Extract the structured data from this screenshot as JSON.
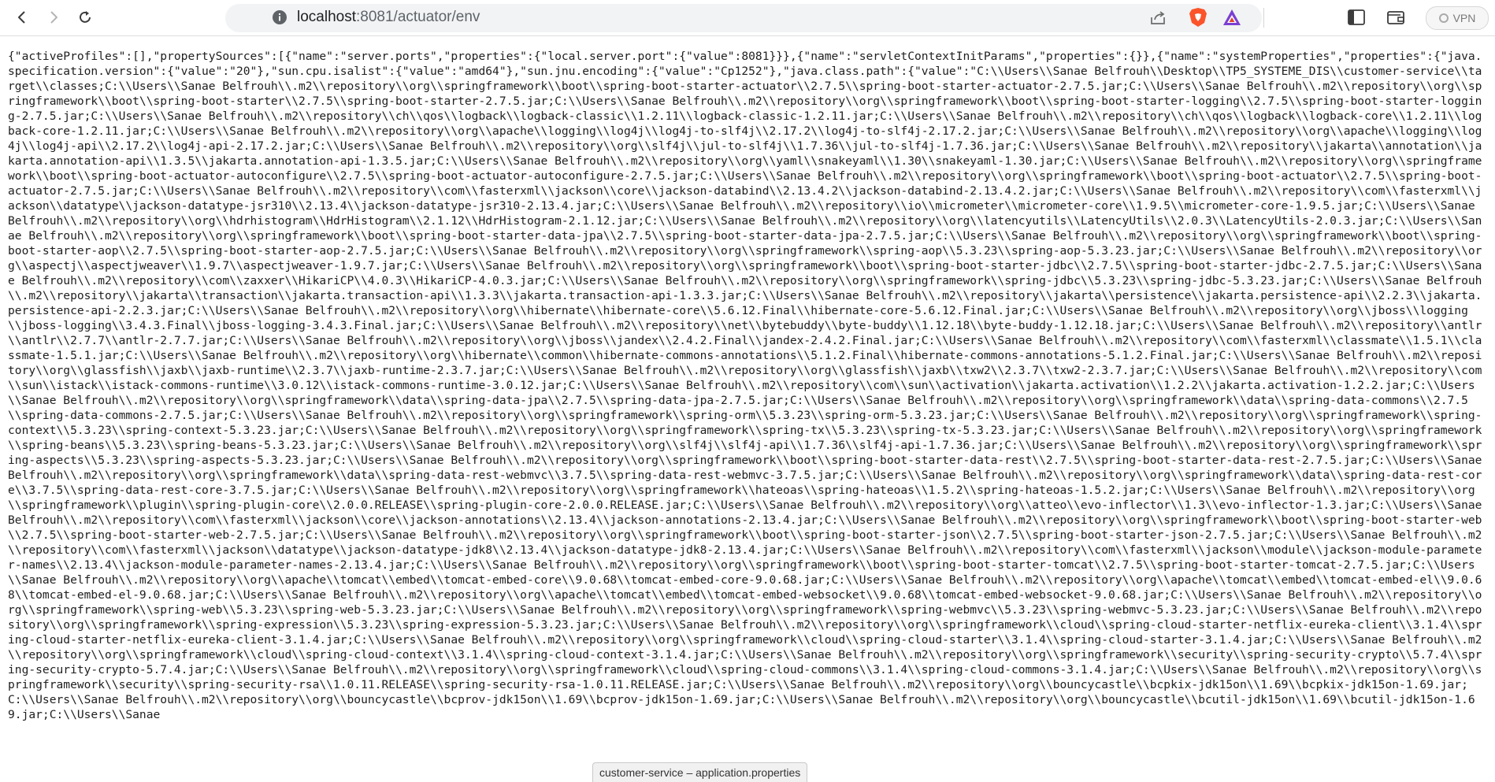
{
  "browser": {
    "url_host": "localhost",
    "url_path": ":8081/actuator/env",
    "vpn_label": "VPN",
    "colors": {
      "brave_orange": "#fb542b",
      "rewards_purple": "#7b3fd2",
      "url_bar_bg": "#f1f3f4"
    }
  },
  "page": {
    "text": "{\"activeProfiles\":[],\"propertySources\":[{\"name\":\"server.ports\",\"properties\":{\"local.server.port\":{\"value\":8081}}},{\"name\":\"servletContextInitParams\",\"properties\":{}},{\"name\":\"systemProperties\",\"properties\":{\"java.specification.version\":{\"value\":\"20\"},\"sun.cpu.isalist\":{\"value\":\"amd64\"},\"sun.jnu.encoding\":{\"value\":\"Cp1252\"},\"java.class.path\":{\"value\":\"C:\\\\Users\\\\Sanae Belfrouh\\\\Desktop\\\\TP5_SYSTEME_DIS\\\\customer-service\\\\target\\\\classes;C:\\\\Users\\\\Sanae Belfrouh\\\\.m2\\\\repository\\\\org\\\\springframework\\\\boot\\\\spring-boot-starter-actuator\\\\2.7.5\\\\spring-boot-starter-actuator-2.7.5.jar;C:\\\\Users\\\\Sanae Belfrouh\\\\.m2\\\\repository\\\\org\\\\springframework\\\\boot\\\\spring-boot-starter\\\\2.7.5\\\\spring-boot-starter-2.7.5.jar;C:\\\\Users\\\\Sanae Belfrouh\\\\.m2\\\\repository\\\\org\\\\springframework\\\\boot\\\\spring-boot-starter-logging\\\\2.7.5\\\\spring-boot-starter-logging-2.7.5.jar;C:\\\\Users\\\\Sanae Belfrouh\\\\.m2\\\\repository\\\\ch\\\\qos\\\\logback\\\\logback-classic\\\\1.2.11\\\\logback-classic-1.2.11.jar;C:\\\\Users\\\\Sanae Belfrouh\\\\.m2\\\\repository\\\\ch\\\\qos\\\\logback\\\\logback-core\\\\1.2.11\\\\logback-core-1.2.11.jar;C:\\\\Users\\\\Sanae Belfrouh\\\\.m2\\\\repository\\\\org\\\\apache\\\\logging\\\\log4j\\\\log4j-to-slf4j\\\\2.17.2\\\\log4j-to-slf4j-2.17.2.jar;C:\\\\Users\\\\Sanae Belfrouh\\\\.m2\\\\repository\\\\org\\\\apache\\\\logging\\\\log4j\\\\log4j-api\\\\2.17.2\\\\log4j-api-2.17.2.jar;C:\\\\Users\\\\Sanae Belfrouh\\\\.m2\\\\repository\\\\org\\\\slf4j\\\\jul-to-slf4j\\\\1.7.36\\\\jul-to-slf4j-1.7.36.jar;C:\\\\Users\\\\Sanae Belfrouh\\\\.m2\\\\repository\\\\jakarta\\\\annotation\\\\jakarta.annotation-api\\\\1.3.5\\\\jakarta.annotation-api-1.3.5.jar;C:\\\\Users\\\\Sanae Belfrouh\\\\.m2\\\\repository\\\\org\\\\yaml\\\\snakeyaml\\\\1.30\\\\snakeyaml-1.30.jar;C:\\\\Users\\\\Sanae Belfrouh\\\\.m2\\\\repository\\\\org\\\\springframework\\\\boot\\\\spring-boot-actuator-autoconfigure\\\\2.7.5\\\\spring-boot-actuator-autoconfigure-2.7.5.jar;C:\\\\Users\\\\Sanae Belfrouh\\\\.m2\\\\repository\\\\org\\\\springframework\\\\boot\\\\spring-boot-actuator\\\\2.7.5\\\\spring-boot-actuator-2.7.5.jar;C:\\\\Users\\\\Sanae Belfrouh\\\\.m2\\\\repository\\\\com\\\\fasterxml\\\\jackson\\\\core\\\\jackson-databind\\\\2.13.4.2\\\\jackson-databind-2.13.4.2.jar;C:\\\\Users\\\\Sanae Belfrouh\\\\.m2\\\\repository\\\\com\\\\fasterxml\\\\jackson\\\\datatype\\\\jackson-datatype-jsr310\\\\2.13.4\\\\jackson-datatype-jsr310-2.13.4.jar;C:\\\\Users\\\\Sanae Belfrouh\\\\.m2\\\\repository\\\\io\\\\micrometer\\\\micrometer-core\\\\1.9.5\\\\micrometer-core-1.9.5.jar;C:\\\\Users\\\\Sanae Belfrouh\\\\.m2\\\\repository\\\\org\\\\hdrhistogram\\\\HdrHistogram\\\\2.1.12\\\\HdrHistogram-2.1.12.jar;C:\\\\Users\\\\Sanae Belfrouh\\\\.m2\\\\repository\\\\org\\\\latencyutils\\\\LatencyUtils\\\\2.0.3\\\\LatencyUtils-2.0.3.jar;C:\\\\Users\\\\Sanae Belfrouh\\\\.m2\\\\repository\\\\org\\\\springframework\\\\boot\\\\spring-boot-starter-data-jpa\\\\2.7.5\\\\spring-boot-starter-data-jpa-2.7.5.jar;C:\\\\Users\\\\Sanae Belfrouh\\\\.m2\\\\repository\\\\org\\\\springframework\\\\boot\\\\spring-boot-starter-aop\\\\2.7.5\\\\spring-boot-starter-aop-2.7.5.jar;C:\\\\Users\\\\Sanae Belfrouh\\\\.m2\\\\repository\\\\org\\\\springframework\\\\spring-aop\\\\5.3.23\\\\spring-aop-5.3.23.jar;C:\\\\Users\\\\Sanae Belfrouh\\\\.m2\\\\repository\\\\org\\\\aspectj\\\\aspectjweaver\\\\1.9.7\\\\aspectjweaver-1.9.7.jar;C:\\\\Users\\\\Sanae Belfrouh\\\\.m2\\\\repository\\\\org\\\\springframework\\\\boot\\\\spring-boot-starter-jdbc\\\\2.7.5\\\\spring-boot-starter-jdbc-2.7.5.jar;C:\\\\Users\\\\Sanae Belfrouh\\\\.m2\\\\repository\\\\com\\\\zaxxer\\\\HikariCP\\\\4.0.3\\\\HikariCP-4.0.3.jar;C:\\\\Users\\\\Sanae Belfrouh\\\\.m2\\\\repository\\\\org\\\\springframework\\\\spring-jdbc\\\\5.3.23\\\\spring-jdbc-5.3.23.jar;C:\\\\Users\\\\Sanae Belfrouh\\\\.m2\\\\repository\\\\jakarta\\\\transaction\\\\jakarta.transaction-api\\\\1.3.3\\\\jakarta.transaction-api-1.3.3.jar;C:\\\\Users\\\\Sanae Belfrouh\\\\.m2\\\\repository\\\\jakarta\\\\persistence\\\\jakarta.persistence-api\\\\2.2.3\\\\jakarta.persistence-api-2.2.3.jar;C:\\\\Users\\\\Sanae Belfrouh\\\\.m2\\\\repository\\\\org\\\\hibernate\\\\hibernate-core\\\\5.6.12.Final\\\\hibernate-core-5.6.12.Final.jar;C:\\\\Users\\\\Sanae Belfrouh\\\\.m2\\\\repository\\\\org\\\\jboss\\\\logging\\\\jboss-logging\\\\3.4.3.Final\\\\jboss-logging-3.4.3.Final.jar;C:\\\\Users\\\\Sanae Belfrouh\\\\.m2\\\\repository\\\\net\\\\bytebuddy\\\\byte-buddy\\\\1.12.18\\\\byte-buddy-1.12.18.jar;C:\\\\Users\\\\Sanae Belfrouh\\\\.m2\\\\repository\\\\antlr\\\\antlr\\\\2.7.7\\\\antlr-2.7.7.jar;C:\\\\Users\\\\Sanae Belfrouh\\\\.m2\\\\repository\\\\org\\\\jboss\\\\jandex\\\\2.4.2.Final\\\\jandex-2.4.2.Final.jar;C:\\\\Users\\\\Sanae Belfrouh\\\\.m2\\\\repository\\\\com\\\\fasterxml\\\\classmate\\\\1.5.1\\\\classmate-1.5.1.jar;C:\\\\Users\\\\Sanae Belfrouh\\\\.m2\\\\repository\\\\org\\\\hibernate\\\\common\\\\hibernate-commons-annotations\\\\5.1.2.Final\\\\hibernate-commons-annotations-5.1.2.Final.jar;C:\\\\Users\\\\Sanae Belfrouh\\\\.m2\\\\repository\\\\org\\\\glassfish\\\\jaxb\\\\jaxb-runtime\\\\2.3.7\\\\jaxb-runtime-2.3.7.jar;C:\\\\Users\\\\Sanae Belfrouh\\\\.m2\\\\repository\\\\org\\\\glassfish\\\\jaxb\\\\txw2\\\\2.3.7\\\\txw2-2.3.7.jar;C:\\\\Users\\\\Sanae Belfrouh\\\\.m2\\\\repository\\\\com\\\\sun\\\\istack\\\\istack-commons-runtime\\\\3.0.12\\\\istack-commons-runtime-3.0.12.jar;C:\\\\Users\\\\Sanae Belfrouh\\\\.m2\\\\repository\\\\com\\\\sun\\\\activation\\\\jakarta.activation\\\\1.2.2\\\\jakarta.activation-1.2.2.jar;C:\\\\Users\\\\Sanae Belfrouh\\\\.m2\\\\repository\\\\org\\\\springframework\\\\data\\\\spring-data-jpa\\\\2.7.5\\\\spring-data-jpa-2.7.5.jar;C:\\\\Users\\\\Sanae Belfrouh\\\\.m2\\\\repository\\\\org\\\\springframework\\\\data\\\\spring-data-commons\\\\2.7.5\\\\spring-data-commons-2.7.5.jar;C:\\\\Users\\\\Sanae Belfrouh\\\\.m2\\\\repository\\\\org\\\\springframework\\\\spring-orm\\\\5.3.23\\\\spring-orm-5.3.23.jar;C:\\\\Users\\\\Sanae Belfrouh\\\\.m2\\\\repository\\\\org\\\\springframework\\\\spring-context\\\\5.3.23\\\\spring-context-5.3.23.jar;C:\\\\Users\\\\Sanae Belfrouh\\\\.m2\\\\repository\\\\org\\\\springframework\\\\spring-tx\\\\5.3.23\\\\spring-tx-5.3.23.jar;C:\\\\Users\\\\Sanae Belfrouh\\\\.m2\\\\repository\\\\org\\\\springframework\\\\spring-beans\\\\5.3.23\\\\spring-beans-5.3.23.jar;C:\\\\Users\\\\Sanae Belfrouh\\\\.m2\\\\repository\\\\org\\\\slf4j\\\\slf4j-api\\\\1.7.36\\\\slf4j-api-1.7.36.jar;C:\\\\Users\\\\Sanae Belfrouh\\\\.m2\\\\repository\\\\org\\\\springframework\\\\spring-aspects\\\\5.3.23\\\\spring-aspects-5.3.23.jar;C:\\\\Users\\\\Sanae Belfrouh\\\\.m2\\\\repository\\\\org\\\\springframework\\\\boot\\\\spring-boot-starter-data-rest\\\\2.7.5\\\\spring-boot-starter-data-rest-2.7.5.jar;C:\\\\Users\\\\Sanae Belfrouh\\\\.m2\\\\repository\\\\org\\\\springframework\\\\data\\\\spring-data-rest-webmvc\\\\3.7.5\\\\spring-data-rest-webmvc-3.7.5.jar;C:\\\\Users\\\\Sanae Belfrouh\\\\.m2\\\\repository\\\\org\\\\springframework\\\\data\\\\spring-data-rest-core\\\\3.7.5\\\\spring-data-rest-core-3.7.5.jar;C:\\\\Users\\\\Sanae Belfrouh\\\\.m2\\\\repository\\\\org\\\\springframework\\\\hateoas\\\\spring-hateoas\\\\1.5.2\\\\spring-hateoas-1.5.2.jar;C:\\\\Users\\\\Sanae Belfrouh\\\\.m2\\\\repository\\\\org\\\\springframework\\\\plugin\\\\spring-plugin-core\\\\2.0.0.RELEASE\\\\spring-plugin-core-2.0.0.RELEASE.jar;C:\\\\Users\\\\Sanae Belfrouh\\\\.m2\\\\repository\\\\org\\\\atteo\\\\evo-inflector\\\\1.3\\\\evo-inflector-1.3.jar;C:\\\\Users\\\\Sanae Belfrouh\\\\.m2\\\\repository\\\\com\\\\fasterxml\\\\jackson\\\\core\\\\jackson-annotations\\\\2.13.4\\\\jackson-annotations-2.13.4.jar;C:\\\\Users\\\\Sanae Belfrouh\\\\.m2\\\\repository\\\\org\\\\springframework\\\\boot\\\\spring-boot-starter-web\\\\2.7.5\\\\spring-boot-starter-web-2.7.5.jar;C:\\\\Users\\\\Sanae Belfrouh\\\\.m2\\\\repository\\\\org\\\\springframework\\\\boot\\\\spring-boot-starter-json\\\\2.7.5\\\\spring-boot-starter-json-2.7.5.jar;C:\\\\Users\\\\Sanae Belfrouh\\\\.m2\\\\repository\\\\com\\\\fasterxml\\\\jackson\\\\datatype\\\\jackson-datatype-jdk8\\\\2.13.4\\\\jackson-datatype-jdk8-2.13.4.jar;C:\\\\Users\\\\Sanae Belfrouh\\\\.m2\\\\repository\\\\com\\\\fasterxml\\\\jackson\\\\module\\\\jackson-module-parameter-names\\\\2.13.4\\\\jackson-module-parameter-names-2.13.4.jar;C:\\\\Users\\\\Sanae Belfrouh\\\\.m2\\\\repository\\\\org\\\\springframework\\\\boot\\\\spring-boot-starter-tomcat\\\\2.7.5\\\\spring-boot-starter-tomcat-2.7.5.jar;C:\\\\Users\\\\Sanae Belfrouh\\\\.m2\\\\repository\\\\org\\\\apache\\\\tomcat\\\\embed\\\\tomcat-embed-core\\\\9.0.68\\\\tomcat-embed-core-9.0.68.jar;C:\\\\Users\\\\Sanae Belfrouh\\\\.m2\\\\repository\\\\org\\\\apache\\\\tomcat\\\\embed\\\\tomcat-embed-el\\\\9.0.68\\\\tomcat-embed-el-9.0.68.jar;C:\\\\Users\\\\Sanae Belfrouh\\\\.m2\\\\repository\\\\org\\\\apache\\\\tomcat\\\\embed\\\\tomcat-embed-websocket\\\\9.0.68\\\\tomcat-embed-websocket-9.0.68.jar;C:\\\\Users\\\\Sanae Belfrouh\\\\.m2\\\\repository\\\\org\\\\springframework\\\\spring-web\\\\5.3.23\\\\spring-web-5.3.23.jar;C:\\\\Users\\\\Sanae Belfrouh\\\\.m2\\\\repository\\\\org\\\\springframework\\\\spring-webmvc\\\\5.3.23\\\\spring-webmvc-5.3.23.jar;C:\\\\Users\\\\Sanae Belfrouh\\\\.m2\\\\repository\\\\org\\\\springframework\\\\spring-expression\\\\5.3.23\\\\spring-expression-5.3.23.jar;C:\\\\Users\\\\Sanae Belfrouh\\\\.m2\\\\repository\\\\org\\\\springframework\\\\cloud\\\\spring-cloud-starter-netflix-eureka-client\\\\3.1.4\\\\spring-cloud-starter-netflix-eureka-client-3.1.4.jar;C:\\\\Users\\\\Sanae Belfrouh\\\\.m2\\\\repository\\\\org\\\\springframework\\\\cloud\\\\spring-cloud-starter\\\\3.1.4\\\\spring-cloud-starter-3.1.4.jar;C:\\\\Users\\\\Sanae Belfrouh\\\\.m2\\\\repository\\\\org\\\\springframework\\\\cloud\\\\spring-cloud-context\\\\3.1.4\\\\spring-cloud-context-3.1.4.jar;C:\\\\Users\\\\Sanae Belfrouh\\\\.m2\\\\repository\\\\org\\\\springframework\\\\security\\\\spring-security-crypto\\\\5.7.4\\\\spring-security-crypto-5.7.4.jar;C:\\\\Users\\\\Sanae Belfrouh\\\\.m2\\\\repository\\\\org\\\\springframework\\\\cloud\\\\spring-cloud-commons\\\\3.1.4\\\\spring-cloud-commons-3.1.4.jar;C:\\\\Users\\\\Sanae Belfrouh\\\\.m2\\\\repository\\\\org\\\\springframework\\\\security\\\\spring-security-rsa\\\\1.0.11.RELEASE\\\\spring-security-rsa-1.0.11.RELEASE.jar;C:\\\\Users\\\\Sanae Belfrouh\\\\.m2\\\\repository\\\\org\\\\bouncycastle\\\\bcpkix-jdk15on\\\\1.69\\\\bcpkix-jdk15on-1.69.jar;C:\\\\Users\\\\Sanae Belfrouh\\\\.m2\\\\repository\\\\org\\\\bouncycastle\\\\bcprov-jdk15on\\\\1.69\\\\bcprov-jdk15on-1.69.jar;C:\\\\Users\\\\Sanae Belfrouh\\\\.m2\\\\repository\\\\org\\\\bouncycastle\\\\bcutil-jdk15on\\\\1.69\\\\bcutil-jdk15on-1.69.jar;C:\\\\Users\\\\Sanae"
  },
  "status_bubble": {
    "text": "customer-service – application.properties"
  }
}
